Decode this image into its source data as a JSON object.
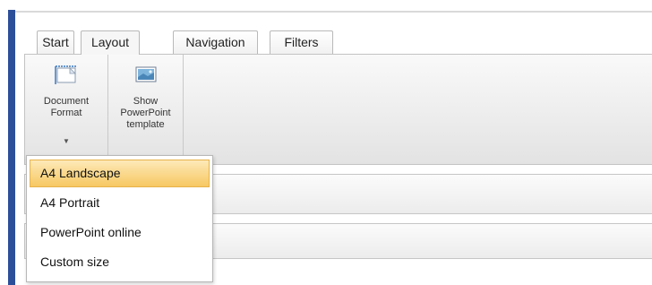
{
  "tabs": [
    {
      "label": "Start",
      "active": false
    },
    {
      "label": "Layout",
      "active": true
    },
    {
      "label": "Navigation",
      "active": false
    },
    {
      "label": "Filters",
      "active": false
    }
  ],
  "ribbon": {
    "document_format": {
      "line1": "Document",
      "line2": "Format",
      "icon": "page-landscape-icon"
    },
    "show_template": {
      "line1": "Show",
      "line2": "PowerPoint",
      "line3": "template",
      "icon": "slide-template-icon"
    }
  },
  "dropdown": {
    "items": [
      {
        "label": "A4 Landscape",
        "selected": true
      },
      {
        "label": "A4 Portrait",
        "selected": false
      },
      {
        "label": "PowerPoint online",
        "selected": false
      },
      {
        "label": "Custom size",
        "selected": false
      }
    ]
  },
  "colors": {
    "accent_bar": "#2c4f9a",
    "selected_item": "#f7c863",
    "ribbon": "#ededed"
  }
}
